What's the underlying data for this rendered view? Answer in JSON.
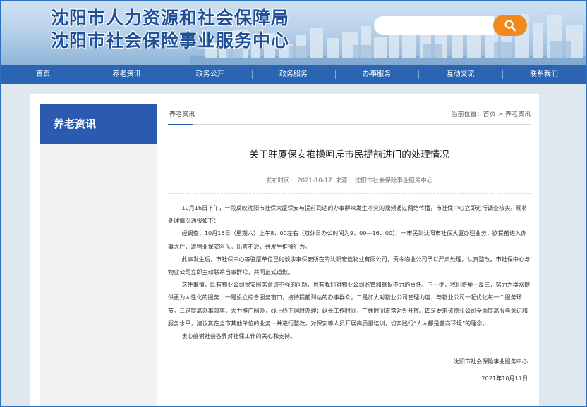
{
  "header": {
    "title_line1": "沈阳市人力资源和社会保障局",
    "title_line2": "沈阳市社会保险事业服务中心",
    "search_placeholder": "",
    "search_icon": "search-icon"
  },
  "nav": {
    "items": [
      "首页",
      "养老资讯",
      "政务公开",
      "政务服务",
      "办事服务",
      "互动交流",
      "联系我们"
    ]
  },
  "sidebar": {
    "title": "养老资讯"
  },
  "breadcrumb": {
    "category": "养老资讯",
    "location_label": "当前位置：",
    "home": "首页",
    "sep": ">",
    "current": "养老资讯"
  },
  "article": {
    "title": "关于驻厦保安推搡呵斥市民提前进门的处理情况",
    "publish_label": "发布时间：",
    "publish_date": "2021-10-17",
    "source_label": "来源：",
    "source": "沈阳市社会保险事业服务中心",
    "paragraphs": [
      "10月16日下午，一段反映沈阳市社保大厦保安与提前到达的办事群众发生冲突的视频通过网络传播，市社保中心立即进行调查核实。现将处理情况通报如下：",
      "经调查，10月16日（星期六）上午8：00左右（双休日办公时间为9：00—16：00），一市民到沈阳市社保大厦办理业务，欲提前进入办事大厅，遭物业保安阿斥，出言不逊，并发生推搡行为。",
      "此事发生后，市社保中心等驻厦单位已约谈涉事保安所在的沈阳宏途物业有限公司，责令物业公司予以严肃处理，认真整改。市社保中心与物业公司立即主动联系当事群众，共同正式道歉。",
      "这件事情，既有物业公司保安服务意识不强的问题，也有我们对物业公司监管和督促不力的责任。下一步，我们将举一反三，努力为群众提供更为人性化的服务：一是设立综合服务窗口，接待提前到达的办事群众。二是加大对物业公司管理力度，与物业公司一起优化每一个服务环节。三是提高办事效率，大力推广网办，线上线下同时办理；延长工作时间，午休时间正常对外开放。四是要求该物业公司全面提高服务意识和服务水平，建议其在全市其他单位的业务一并进行整改，对保安等人员开展高质量培训，切实践行“人人都是营商环境”的理念。",
      "衷心感谢社会各界对社保工作的关心和支持。"
    ],
    "signature": "沈阳市社会保险事业服务中心",
    "sign_date": "2021年10月17日"
  },
  "colors": {
    "nav_bg": "#2a64b3",
    "accent_blue": "#2a5bb0",
    "search_orange": "#f08a1d",
    "title_blue": "#1f4f97"
  }
}
